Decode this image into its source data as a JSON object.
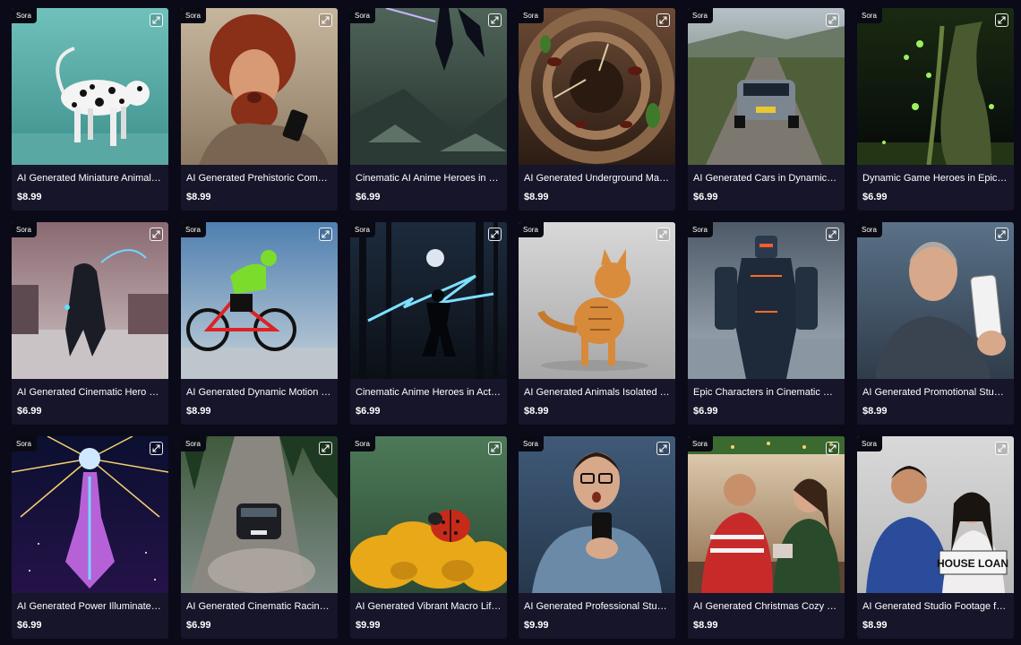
{
  "products": [
    {
      "badge": "Sora",
      "title": "AI Generated Miniature Animal…",
      "price": "$8.99",
      "icon": "expand-icon",
      "bg": [
        "#70c1bc",
        "#3d8f8b"
      ],
      "subject": "dalmatian"
    },
    {
      "badge": "Sora",
      "title": "AI Generated Prehistoric Come…",
      "price": "$8.99",
      "icon": "expand-icon",
      "bg": [
        "#c7b69e",
        "#8d7a63"
      ],
      "subject": "caveman"
    },
    {
      "badge": "Sora",
      "title": "Cinematic AI Anime Heroes in …",
      "price": "$6.99",
      "icon": "expand-icon",
      "bg": [
        "#4f6459",
        "#24302c"
      ],
      "subject": "anime-warrior"
    },
    {
      "badge": "Sora",
      "title": "AI Generated Underground Ma…",
      "price": "$8.99",
      "icon": "expand-icon",
      "bg": [
        "#6b4a35",
        "#2c1d14"
      ],
      "subject": "ant-tunnel"
    },
    {
      "badge": "Sora",
      "title": "AI Generated Cars in Dynamic …",
      "price": "$6.99",
      "icon": "expand-icon",
      "bg": [
        "#b6c0c8",
        "#4a5a3a"
      ],
      "subject": "rally-car"
    },
    {
      "badge": "Sora",
      "title": "Dynamic Game Heroes in Epic …",
      "price": "$6.99",
      "icon": "expand-icon",
      "bg": [
        "#1a2a12",
        "#06090a"
      ],
      "subject": "forest-sorcerer"
    },
    {
      "badge": "Sora",
      "title": "AI Generated Cinematic Hero S…",
      "price": "$6.99",
      "icon": "expand-icon",
      "bg": [
        "#8a6a72",
        "#cfc3c4"
      ],
      "subject": "hooded-archer"
    },
    {
      "badge": "Sora",
      "title": "AI Generated Dynamic Motion i…",
      "price": "$8.99",
      "icon": "expand-icon",
      "bg": [
        "#4f7fb0",
        "#c5d2da"
      ],
      "subject": "cyclist"
    },
    {
      "badge": "Sora",
      "title": "Cinematic Anime Heroes in Act…",
      "price": "$6.99",
      "icon": "expand-icon",
      "bg": [
        "#1c2b3d",
        "#0c1016"
      ],
      "subject": "lightning-hero"
    },
    {
      "badge": "Sora",
      "title": "AI Generated Animals Isolated …",
      "price": "$8.99",
      "icon": "expand-icon",
      "bg": [
        "#d8d8d8",
        "#a7a7a7"
      ],
      "subject": "kitten"
    },
    {
      "badge": "Sora",
      "title": "Epic Characters in Cinematic H…",
      "price": "$6.99",
      "icon": "expand-icon",
      "bg": [
        "#4e5a68",
        "#a7b2bc"
      ],
      "subject": "mech-robot"
    },
    {
      "badge": "Sora",
      "title": "AI Generated Promotional Stud…",
      "price": "$8.99",
      "icon": "expand-icon",
      "bg": [
        "#5a7188",
        "#2f3c4a"
      ],
      "subject": "man-phone"
    },
    {
      "badge": "Sora",
      "title": "AI Generated Power Illuminate…",
      "price": "$6.99",
      "icon": "expand-icon",
      "bg": [
        "#0b1030",
        "#241248"
      ],
      "subject": "cosmic-figure"
    },
    {
      "badge": "Sora",
      "title": "AI Generated Cinematic Racin…",
      "price": "$6.99",
      "icon": "expand-icon",
      "bg": [
        "#3f5a3c",
        "#7d8a86"
      ],
      "subject": "forest-rally"
    },
    {
      "badge": "Sora",
      "title": "AI Generated Vibrant Macro Lif…",
      "price": "$9.99",
      "icon": "expand-icon",
      "bg": [
        "#4d7a58",
        "#2c4a34"
      ],
      "subject": "ladybug"
    },
    {
      "badge": "Sora",
      "title": "AI Generated Professional Stud…",
      "price": "$9.99",
      "icon": "expand-icon",
      "bg": [
        "#3f5a78",
        "#26384c"
      ],
      "subject": "surprised-man"
    },
    {
      "badge": "Sora",
      "title": "AI Generated Christmas Cozy …",
      "price": "$8.99",
      "icon": "expand-icon",
      "bg": [
        "#e6d4b8",
        "#8a6a4a"
      ],
      "subject": "christmas-couple"
    },
    {
      "badge": "Sora",
      "title": "AI Generated Studio Footage f…",
      "price": "$8.99",
      "icon": "expand-icon",
      "bg": [
        "#d9d9d9",
        "#b9b9b9"
      ],
      "subject": "house-loan-couple",
      "sign_text": "HOUSE LOAN"
    }
  ]
}
